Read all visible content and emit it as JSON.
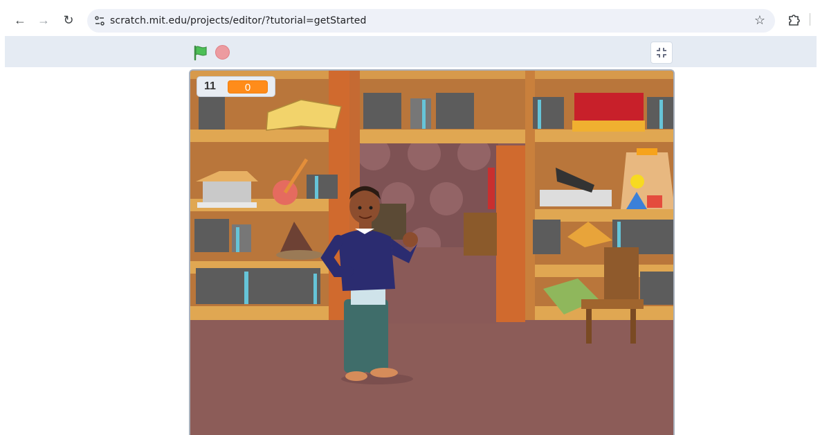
{
  "browser": {
    "url": "scratch.mit.edu/projects/editor/?tutorial=getStarted",
    "back_icon": "←",
    "forward_icon": "→",
    "reload_icon": "↻",
    "star_icon": "☆"
  },
  "stage_header": {
    "flag_icon": "green-flag-icon",
    "stop_icon": "stop-icon",
    "fullscreen_icon": "exit-fullscreen-icon"
  },
  "monitor": {
    "label": "11",
    "value": "0"
  },
  "colors": {
    "accent_orange": "#ff8c1a",
    "flag_green": "#4cbf56",
    "stop_red": "#ec9ba0",
    "floor": "#8b5b57",
    "shelf_wood": "#d98c46"
  }
}
